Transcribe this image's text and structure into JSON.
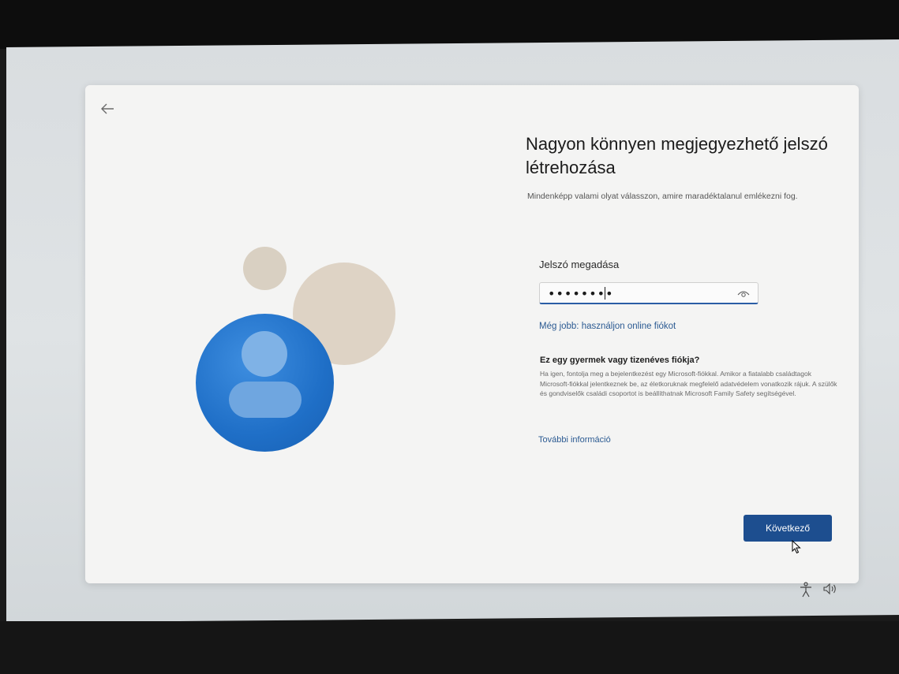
{
  "back_icon": "arrow-left-icon",
  "heading": "Nagyon könnyen megjegyezhető jelszó létrehozása",
  "subheading": "Mindenképp valami olyat válasszon, amire maradéktalanul emlékezni fog.",
  "password": {
    "label": "Jelszó megadása",
    "value": "••••••••",
    "reveal_icon": "eye-icon"
  },
  "online_account_link": "Még jobb: használjon online fiókot",
  "child_section": {
    "heading": "Ez egy gyermek vagy tizenéves fiókja?",
    "text": "Ha igen, fontolja meg a bejelentkezést egy Microsoft-fiókkal. Amikor a fiatalabb családtagok Microsoft-fiókkal jelentkeznek be, az életkoruknak megfelelő adatvédelem vonatkozik rájuk. A szülők és gondviselők családi csoportot is beállíthatnak Microsoft Family Safety segítségével.",
    "more_info_link": "További információ"
  },
  "next_button": "Következő",
  "taskbar": {
    "accessibility_icon": "accessibility-icon",
    "volume_icon": "volume-icon"
  },
  "colors": {
    "accent": "#1d4e8f",
    "link": "#2b5a92",
    "avatar": "#1f6fc7"
  }
}
